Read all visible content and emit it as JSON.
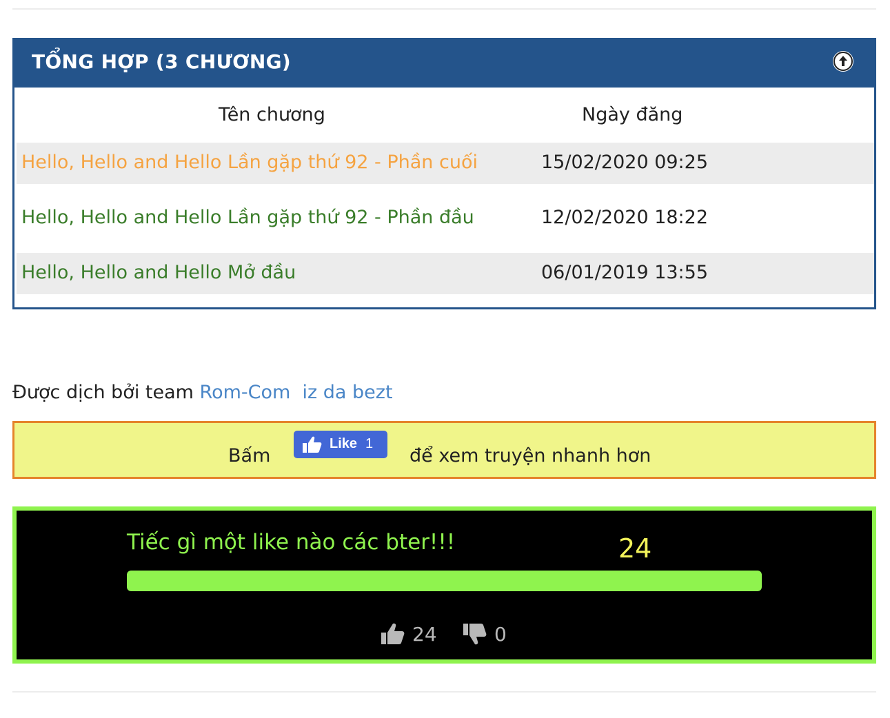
{
  "panel": {
    "title": "TỔNG HỢP (3 CHƯƠNG)",
    "header_color": "#24548b",
    "columns": {
      "name": "Tên chương",
      "date": "Ngày đăng"
    },
    "rows": [
      {
        "title": "Hello, Hello and Hello Lần gặp thứ 92 - Phần cuối",
        "date": "15/02/2020 09:25",
        "color": "#f5a341"
      },
      {
        "title": "Hello, Hello and Hello Lần gặp thứ 92 - Phần đầu",
        "date": "12/02/2020 18:22",
        "color": "#3a7d2a"
      },
      {
        "title": "Hello, Hello and Hello Mở đầu",
        "date": "06/01/2019 13:55",
        "color": "#3a7d2a"
      }
    ]
  },
  "credit": {
    "prefix": "Được dịch bởi team ",
    "team": "Rom-Com",
    "suffix": "iz da bezt",
    "link_color": "#4a86c7"
  },
  "like_box": {
    "before": "Bấm",
    "after": "để xem truyện nhanh hơn",
    "fb_label": "Like",
    "fb_count": "1",
    "bg": "#f0f58a",
    "border": "#e5832b"
  },
  "vote": {
    "title": "Tiếc gì một like nào các bter!!!",
    "total": "24",
    "progress_fraction": 1.0,
    "up_count": "24",
    "down_count": "0",
    "accent": "#8ff34e",
    "count_color": "#f3f35a"
  }
}
